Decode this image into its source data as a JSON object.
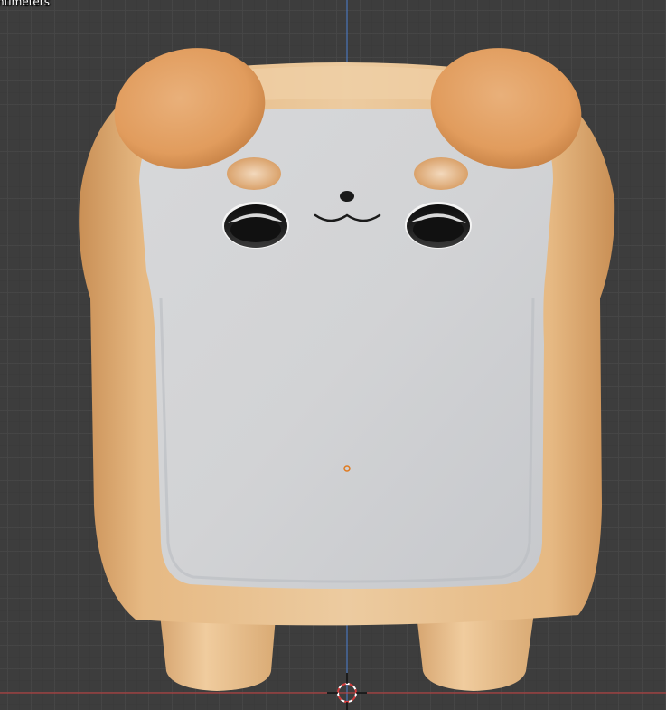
{
  "viewport": {
    "unit_label": "ntimeters",
    "axis_x_color": "#c94040",
    "axis_z_color": "#4a7fd1",
    "origin_color": "#e07a1f"
  },
  "model": {
    "crust_color": "#e7c08f",
    "crumb_color": "#d3d4d6",
    "ear_color": "#e4a062",
    "eye_color": "#1a1a1a"
  },
  "cursor": {
    "icon": "3d-cursor-icon"
  }
}
